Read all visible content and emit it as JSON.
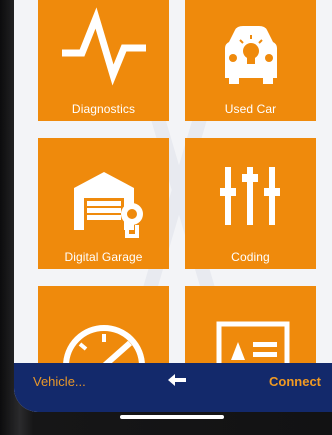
{
  "tiles": [
    {
      "label": "Diagnostics",
      "icon": "pulse-icon"
    },
    {
      "label": "Used Car",
      "icon": "car-lightbulb-icon"
    },
    {
      "label": "Digital Garage",
      "icon": "garage-icon"
    },
    {
      "label": "Coding",
      "icon": "sliders-icon"
    },
    {
      "label": "",
      "icon": "speedometer-icon"
    },
    {
      "label": "",
      "icon": "id-card-icon"
    }
  ],
  "bottom_nav": {
    "vehicle_label": "Vehicle...",
    "back_icon": "arrow-left-icon",
    "connect_label": "Connect"
  },
  "colors": {
    "tile": "#ef8a0c",
    "nav_bar": "#13296b",
    "nav_text": "#f19a22",
    "screen_bg": "#f3f4f7"
  }
}
